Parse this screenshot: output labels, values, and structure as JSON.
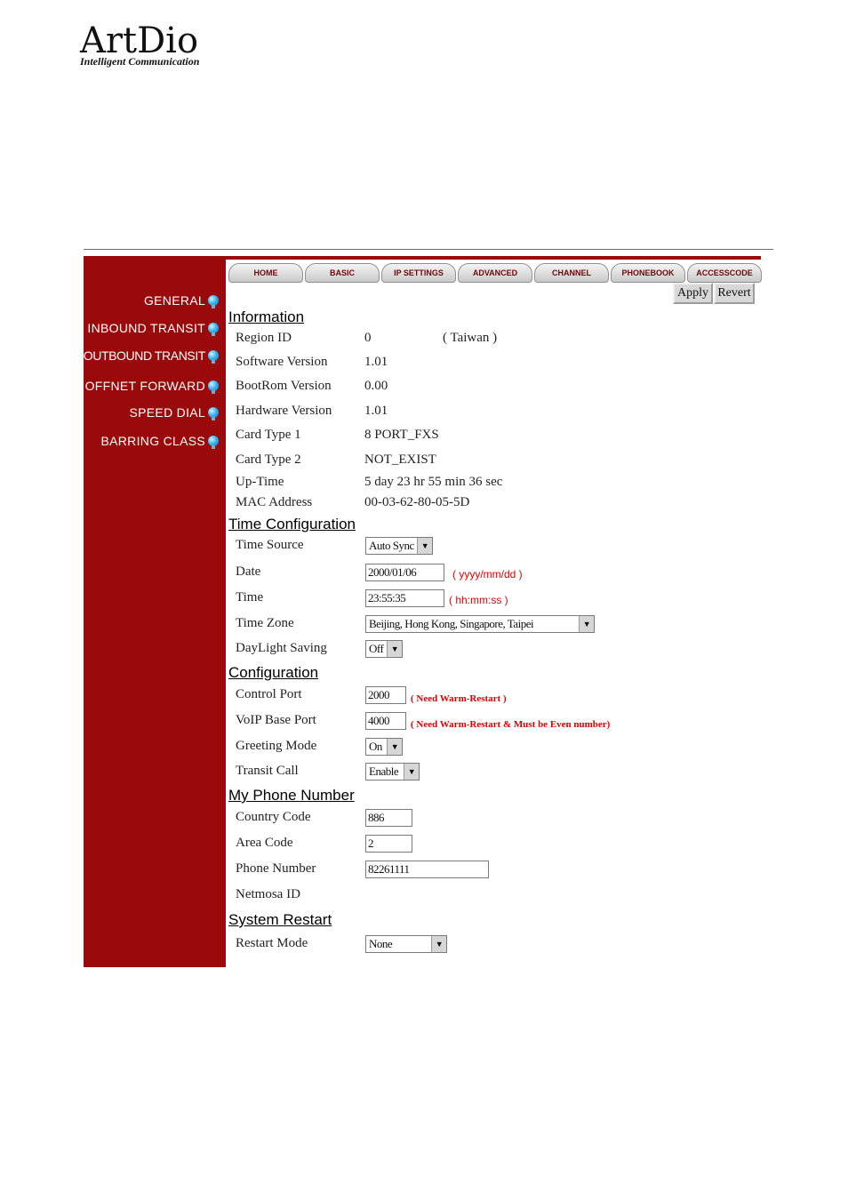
{
  "logo": {
    "brand": "ArtDio",
    "tagline": "Intelligent Communication"
  },
  "sidebar": {
    "items": [
      {
        "label": "GENERAL"
      },
      {
        "label": "INBOUND TRANSIT"
      },
      {
        "label": "OUTBOUND TRANSIT"
      },
      {
        "label": "OFFNET FORWARD"
      },
      {
        "label": "SPEED DIAL"
      },
      {
        "label": "BARRING CLASS"
      }
    ],
    "bulb_icon": "light-bulb-icon"
  },
  "tabs": [
    {
      "label": "HOME"
    },
    {
      "label": "BASIC"
    },
    {
      "label": "IP SETTINGS"
    },
    {
      "label": "ADVANCED"
    },
    {
      "label": "CHANNEL"
    },
    {
      "label": "PHONEBOOK"
    },
    {
      "label": "ACCESSCODE"
    }
  ],
  "actions": {
    "apply": "Apply",
    "revert": "Revert"
  },
  "information": {
    "title": "Information",
    "region_id": {
      "label": "Region ID",
      "value": "0",
      "note": "( Taiwan )"
    },
    "software_version": {
      "label": "Software Version",
      "value": "1.01"
    },
    "bootrom_version": {
      "label": "BootRom Version",
      "value": "0.00"
    },
    "hardware_version": {
      "label": "Hardware Version",
      "value": "1.01"
    },
    "card_type_1": {
      "label": "Card Type 1",
      "value": "8 PORT_FXS"
    },
    "card_type_2": {
      "label": "Card Type 2",
      "value": "NOT_EXIST"
    },
    "up_time": {
      "label": "Up-Time",
      "value": "5 day 23 hr 55 min 36 sec"
    },
    "mac_address": {
      "label": "MAC Address",
      "value": "00-03-62-80-05-5D"
    }
  },
  "time_config": {
    "title": "Time Configuration",
    "time_source": {
      "label": "Time Source",
      "value": "Auto Sync"
    },
    "date": {
      "label": "Date",
      "value": "2000/01/06",
      "hint": "( yyyy/mm/dd )"
    },
    "time": {
      "label": "Time",
      "value": "23:55:35",
      "hint": "( hh:mm:ss )"
    },
    "time_zone": {
      "label": "Time Zone",
      "value": "Beijing, Hong Kong, Singapore, Taipei"
    },
    "daylight_saving": {
      "label": "DayLight Saving",
      "value": "Off"
    }
  },
  "configuration": {
    "title": "Configuration",
    "control_port": {
      "label": "Control Port",
      "value": "2000",
      "note": "( Need Warm-Restart )"
    },
    "voip_base_port": {
      "label": "VoIP Base Port",
      "value": "4000",
      "note": "( Need Warm-Restart & Must be Even number)"
    },
    "greeting_mode": {
      "label": "Greeting Mode",
      "value": "On"
    },
    "transit_call": {
      "label": "Transit Call",
      "value": "Enable"
    }
  },
  "phone_number": {
    "title": "My Phone Number",
    "country_code": {
      "label": "Country Code",
      "value": "886"
    },
    "area_code": {
      "label": "Area Code",
      "value": "2"
    },
    "phone_number": {
      "label": "Phone Number",
      "value": "82261111"
    },
    "netmosa_id": {
      "label": "Netmosa ID"
    }
  },
  "system_restart": {
    "title": "System Restart",
    "restart_mode": {
      "label": "Restart Mode",
      "value": "None"
    }
  },
  "colors": {
    "sidebar": "#9b0a0a",
    "hint": "#e00000"
  }
}
